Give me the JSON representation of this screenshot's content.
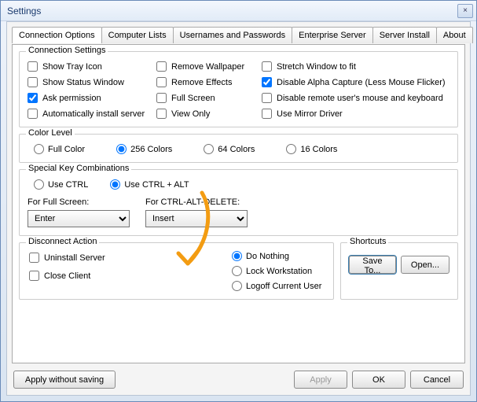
{
  "window": {
    "title": "Settings",
    "close_icon": "×"
  },
  "tabs": [
    "Connection Options",
    "Computer Lists",
    "Usernames and Passwords",
    "Enterprise Server",
    "Server Install",
    "About"
  ],
  "conn": {
    "legend": "Connection Settings",
    "c1": [
      {
        "label": "Show Tray Icon",
        "checked": false
      },
      {
        "label": "Show Status Window",
        "checked": false
      },
      {
        "label": "Ask permission",
        "checked": true
      },
      {
        "label": "Automatically install server",
        "checked": false
      }
    ],
    "c2": [
      {
        "label": "Remove Wallpaper",
        "checked": false
      },
      {
        "label": "Remove Effects",
        "checked": false
      },
      {
        "label": "Full Screen",
        "checked": false
      },
      {
        "label": "View Only",
        "checked": false
      }
    ],
    "c3": [
      {
        "label": "Stretch Window to fit",
        "checked": false
      },
      {
        "label": "Disable Alpha Capture (Less Mouse Flicker)",
        "checked": true
      },
      {
        "label": "Disable remote user's mouse and keyboard",
        "checked": false
      },
      {
        "label": "Use Mirror Driver",
        "checked": false
      }
    ]
  },
  "color": {
    "legend": "Color Level",
    "options": [
      "Full Color",
      "256 Colors",
      "64 Colors",
      "16 Colors"
    ],
    "selected": "256 Colors"
  },
  "skc": {
    "legend": "Special Key Combinations",
    "mode_options": [
      "Use CTRL",
      "Use CTRL + ALT"
    ],
    "mode_selected": "Use CTRL + ALT",
    "fs_label": "For Full Screen:",
    "fs_value": "Enter",
    "cad_label": "For CTRL-ALT-DELETE:",
    "cad_value": "Insert"
  },
  "disc": {
    "legend": "Disconnect Action",
    "left": [
      {
        "label": "Uninstall Server",
        "checked": false
      },
      {
        "label": "Close Client",
        "checked": false
      }
    ],
    "radios": [
      "Do Nothing",
      "Lock Workstation",
      "Logoff Current User"
    ],
    "radio_selected": "Do Nothing"
  },
  "shortcuts": {
    "legend": "Shortcuts",
    "save": "Save To...",
    "open": "Open..."
  },
  "footer": {
    "apply_no_save": "Apply without saving",
    "apply": "Apply",
    "ok": "OK",
    "cancel": "Cancel"
  }
}
